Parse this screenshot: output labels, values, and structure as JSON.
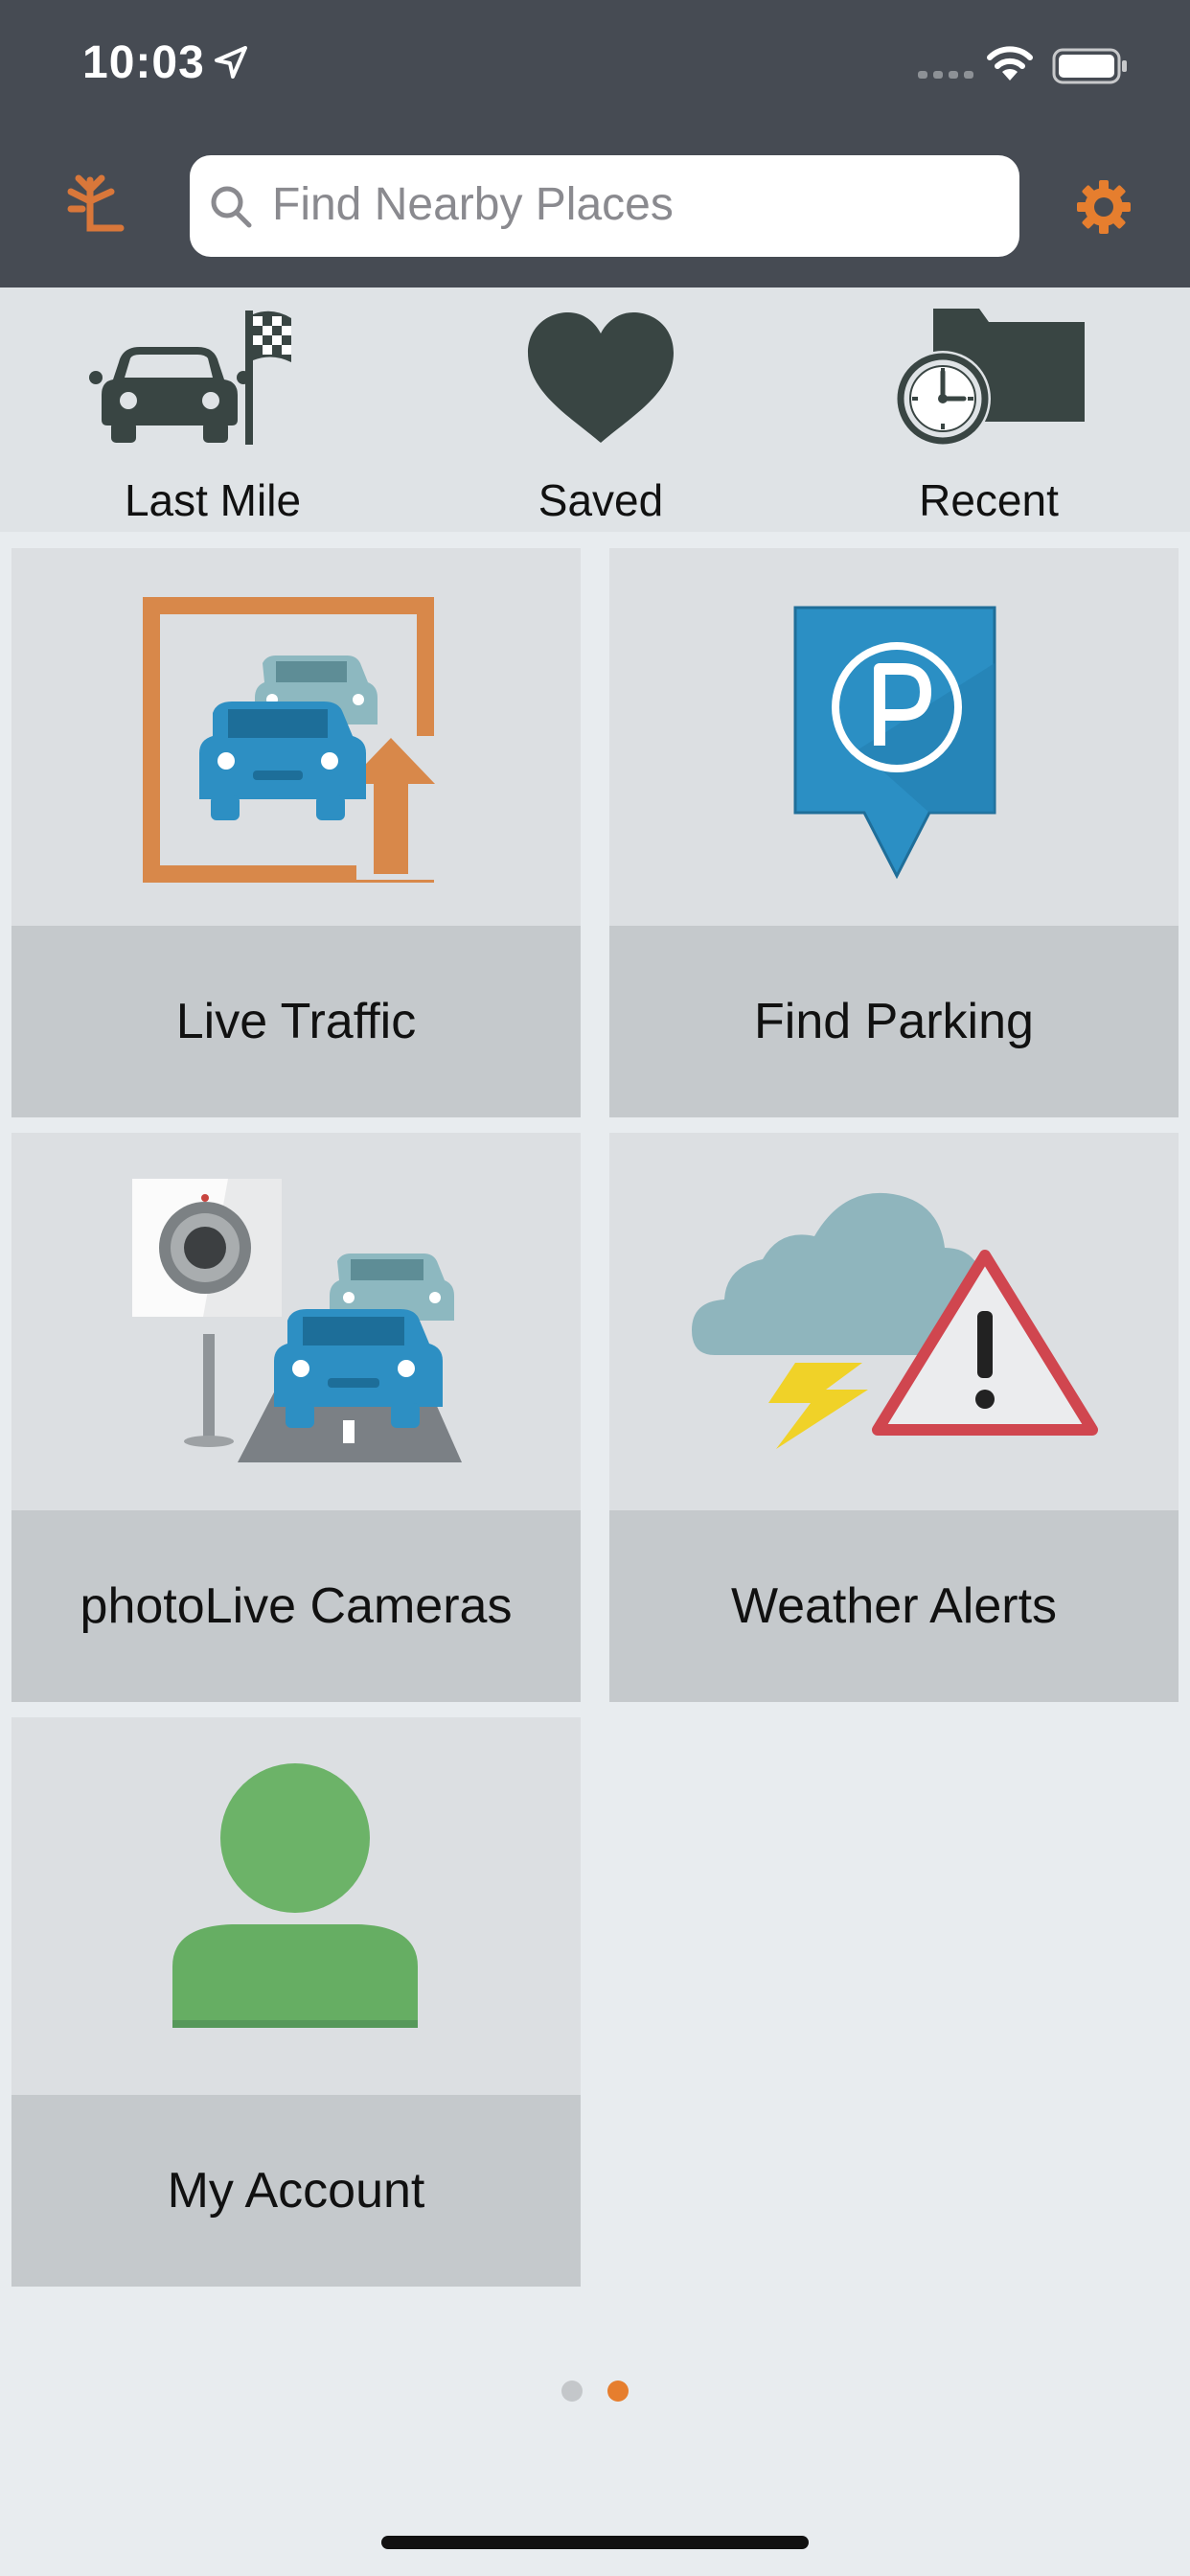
{
  "status_bar": {
    "time": "10:03"
  },
  "search": {
    "placeholder": "Find Nearby Places"
  },
  "quick_access": [
    {
      "label": "Last Mile",
      "icon": "car-finish-flag-icon"
    },
    {
      "label": "Saved",
      "icon": "heart-icon"
    },
    {
      "label": "Recent",
      "icon": "clock-folder-icon"
    }
  ],
  "tiles": [
    {
      "label": "Live Traffic",
      "icon": "live-traffic-icon"
    },
    {
      "label": "Find Parking",
      "icon": "parking-sign-icon"
    },
    {
      "label": "photoLive Cameras",
      "icon": "traffic-camera-icon"
    },
    {
      "label": "Weather Alerts",
      "icon": "weather-alert-icon"
    },
    {
      "label": "My Account",
      "icon": "user-account-icon"
    }
  ],
  "pager": {
    "page_count": 2,
    "current_page": 2
  },
  "colors": {
    "header_bg": "#464b53",
    "accent_orange": "#e67e2e",
    "traffic_blue": "#2d8fc3",
    "parking_blue": "#2b8fc4",
    "account_green": "#66ae63",
    "alert_red": "#d0464f",
    "bolt_yellow": "#f0d228",
    "icon_dark": "#394543"
  }
}
